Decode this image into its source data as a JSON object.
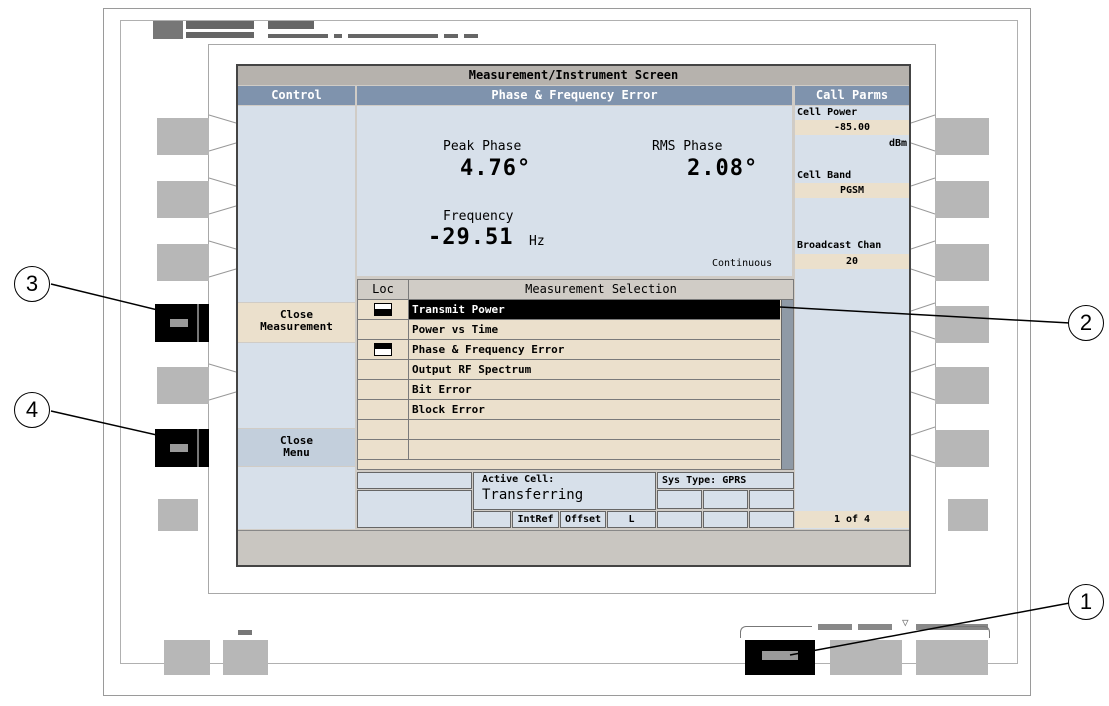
{
  "screen": {
    "title": "Measurement/Instrument Screen",
    "control_header": "Control",
    "measurement_header": "Phase & Frequency Error",
    "call_parms_header": "Call Parms",
    "control_menu": {
      "close_measurement": "Close\nMeasurement",
      "close_menu": "Close\nMenu"
    },
    "results": {
      "peak_phase_label": "Peak Phase",
      "peak_phase_value": "4.76°",
      "rms_phase_label": "RMS Phase",
      "rms_phase_value": "2.08°",
      "frequency_label": "Frequency",
      "frequency_value": "-29.51",
      "frequency_unit": "Hz",
      "mode": "Continuous"
    },
    "selection": {
      "loc_header": "Loc",
      "title": "Measurement Selection",
      "items": [
        "Transmit Power",
        "Power vs Time",
        "Phase & Frequency Error",
        "Output RF Spectrum",
        "Bit Error",
        "Block Error",
        "",
        ""
      ],
      "selected_index": 0
    },
    "call_parms": {
      "cell_power_label": "Cell Power",
      "cell_power_value": "-85.00",
      "cell_power_unit": "dBm",
      "cell_band_label": "Cell Band",
      "cell_band_value": "PGSM",
      "broadcast_chan_label": "Broadcast Chan",
      "broadcast_chan_value": "20",
      "page": "1 of 4"
    },
    "status": {
      "active_cell_label": "Active Cell:",
      "active_cell_value": "Transferring",
      "sys_type": "Sys Type: GPRS",
      "intref": "IntRef",
      "offset": "Offset",
      "l": "L"
    }
  },
  "callouts": [
    "1",
    "2",
    "3",
    "4"
  ]
}
